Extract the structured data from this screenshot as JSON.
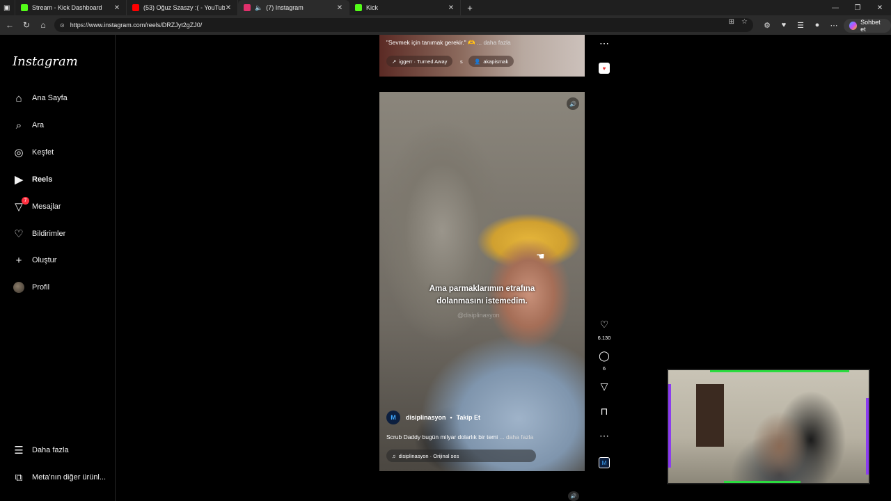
{
  "tabs": [
    {
      "title": "Stream - Kick Dashboard",
      "favicon_color": "#53fc18",
      "active": false
    },
    {
      "title": "(53) Oğuz Szaszy :( - YouTube",
      "favicon_color": "#ff0000",
      "active": false
    },
    {
      "title": "(7) Instagram",
      "favicon_color": "#e1306c",
      "active": true
    },
    {
      "title": "Kick",
      "favicon_color": "#53fc18",
      "active": false
    }
  ],
  "browser": {
    "url": "https://www.instagram.com/reels/DRZJyt2gZJ0/",
    "chat_label": "Sohbet et"
  },
  "sidebar": {
    "logo": "Instagram",
    "items": [
      {
        "label": "Ana Sayfa",
        "icon": "home-icon"
      },
      {
        "label": "Ara",
        "icon": "search-icon"
      },
      {
        "label": "Keşfet",
        "icon": "compass-icon"
      },
      {
        "label": "Reels",
        "icon": "reels-icon"
      },
      {
        "label": "Mesajlar",
        "icon": "messenger-icon",
        "badge": "7"
      },
      {
        "label": "Bildirimler",
        "icon": "heart-icon"
      },
      {
        "label": "Oluştur",
        "icon": "plus-icon"
      },
      {
        "label": "Profil",
        "icon": "avatar"
      }
    ],
    "more_label": "Daha fazla",
    "meta_label": "Meta'nın diğer ürünl..."
  },
  "prev_reel": {
    "caption": "\"Sevmek için tanımak gerekir.\" 🫶",
    "more": "... daha fazla",
    "audio": "iggerr · Turned Away",
    "extra": "s",
    "user_tag": "akapismak"
  },
  "reel": {
    "subtitle_line1": "Ama parmaklarımın etrafına",
    "subtitle_line2": "dolanmasını istemedim.",
    "watermark": "@disiplinasyon",
    "author": "disiplinasyon",
    "follow": "Takip Et",
    "caption": "Scrub Daddy bugün milyar dolarlık bir temi",
    "more": "... daha fazla",
    "audio": "disiplinasyon · Orijinal ses",
    "likes": "6.130",
    "comments": "6"
  },
  "colors": {
    "kick_green": "#53fc18",
    "youtube_red": "#ff0000",
    "badge_red": "#ff3040",
    "cam_frame_green": "#2bdc3f",
    "cam_frame_purple": "#8b3cf0"
  }
}
